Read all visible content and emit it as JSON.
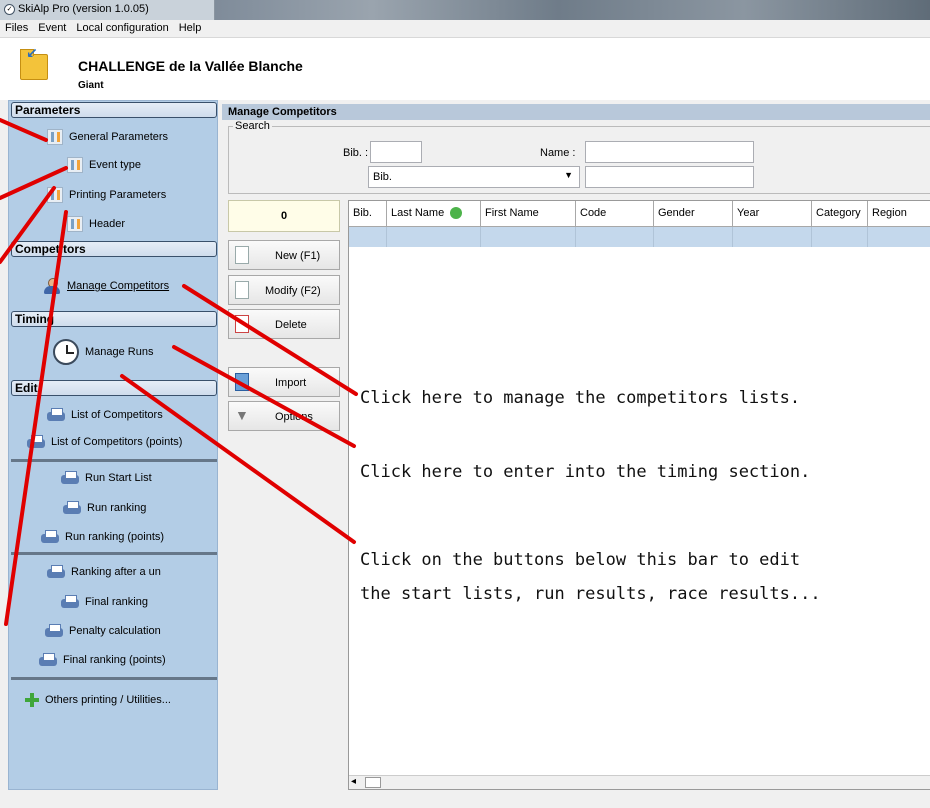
{
  "window": {
    "title": "SkiAlp Pro (version 1.0.05)"
  },
  "menu": [
    "Files",
    "Event",
    "Local configuration",
    "Help"
  ],
  "event": {
    "title": "CHALLENGE de la Vallée Blanche",
    "subtitle": "Giant"
  },
  "sidebar": {
    "parameters": {
      "heading": "Parameters",
      "items": [
        "General Parameters",
        "Event type",
        "Printing Parameters",
        "Header"
      ]
    },
    "competitors": {
      "heading": "Competitors",
      "items": [
        "Manage Competitors"
      ]
    },
    "timing": {
      "heading": "Timing",
      "items": [
        "Manage Runs"
      ]
    },
    "edit": {
      "heading": "Edit",
      "group1": [
        "List of Competitors",
        "List of Competitors (points)"
      ],
      "group2": [
        "Run Start List",
        "Run ranking",
        "Run ranking (points)"
      ],
      "group3": [
        "Ranking after a un",
        "Final ranking",
        "Penalty calculation",
        "Final ranking (points)"
      ],
      "utilities": "Others printing / Utilities..."
    }
  },
  "main": {
    "heading": "Manage Competitors",
    "search": {
      "legend": "Search",
      "bib_label": "Bib. :",
      "name_label": "Name :",
      "bib_value": "",
      "name_value": "",
      "combo_selected": "Bib.",
      "combo_value": ""
    },
    "count": "0",
    "buttons": {
      "new": "New (F1)",
      "modify": "Modify (F2)",
      "delete": "Delete",
      "import": "Import",
      "options": "Options"
    },
    "columns": [
      "Bib.",
      "Last Name",
      "First Name",
      "Code",
      "Gender",
      "Year",
      "Category",
      "Region"
    ]
  },
  "annotations": {
    "competitors": "Click here to manage the competitors lists.",
    "timing": "Click here to enter into the timing section.",
    "edit_line1": "Click on the buttons below this bar to edit",
    "edit_line2": "the start lists, run results, race results..."
  },
  "colors": {
    "sidebar_bg": "#b3cde6",
    "annotation_line": "#e00000",
    "selected_row": "#c4d8ec"
  }
}
